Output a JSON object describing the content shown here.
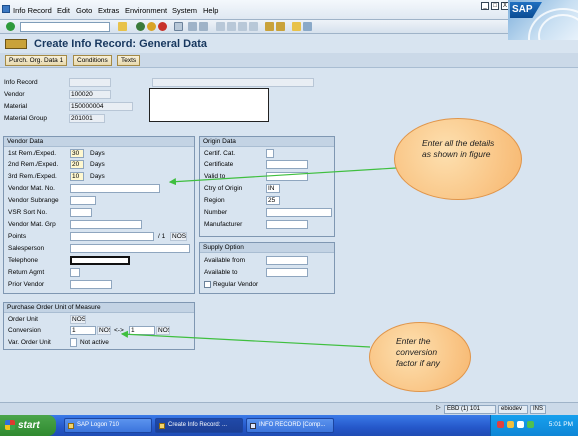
{
  "menu": [
    "Info Record",
    "Edit",
    "Goto",
    "Extras",
    "Environment",
    "System",
    "Help"
  ],
  "window_controls": [
    "_",
    "□",
    "X"
  ],
  "logo_text": "SAP",
  "title": "Create Info Record: General Data",
  "app_buttons": [
    "Purch. Org. Data 1",
    "Conditions",
    "Texts"
  ],
  "header": {
    "info_record_label": "Info Record",
    "info_record_value": "",
    "vendor_label": "Vendor",
    "vendor_value": "100020",
    "material_label": "Material",
    "material_value": "150000004",
    "material_group_label": "Material Group",
    "material_group_value": "201001"
  },
  "vendor_data": {
    "title": "Vendor Data",
    "rem1_label": "1st Rem./Exped.",
    "rem1_value": "30",
    "rem1_unit": "Days",
    "rem2_label": "2nd Rem./Exped.",
    "rem2_value": "20",
    "rem2_unit": "Days",
    "rem3_label": "3rd Rem./Exped.",
    "rem3_value": "10",
    "rem3_unit": "Days",
    "vendor_mat_no_label": "Vendor Mat. No.",
    "vendor_subrange_label": "Vendor Subrange",
    "vsr_sort_no_label": "VSR Sort No.",
    "vendor_mat_grp_label": "Vendor Mat. Grp",
    "points_label": "Points",
    "points_per": "/ 1",
    "points_unit": "NOS",
    "salesperson_label": "Salesperson",
    "telephone_label": "Telephone",
    "return_agmt_label": "Return Agmt",
    "prior_vendor_label": "Prior Vendor"
  },
  "origin_data": {
    "title": "Origin Data",
    "certif_cat_label": "Certif. Cat.",
    "certificate_label": "Certificate",
    "valid_to_label": "Valid to",
    "ctry_label": "Ctry of Origin",
    "ctry_value": "IN",
    "region_label": "Region",
    "region_value": "25",
    "number_label": "Number",
    "manufacturer_label": "Manufacturer"
  },
  "supply_option": {
    "title": "Supply Option",
    "available_from_label": "Available from",
    "available_to_label": "Available to",
    "regular_vendor_label": "Regular Vendor"
  },
  "po_unit": {
    "title": "Purchase Order Unit of Measure",
    "order_unit_label": "Order Unit",
    "order_unit_value": "NOS",
    "conversion_label": "Conversion",
    "conv_left_value": "1",
    "conv_left_unit": "NOS",
    "conv_arrow": "<->",
    "conv_right_value": "1",
    "conv_right_unit": "NOS",
    "var_order_unit_label": "Var. Order Unit",
    "not_active_label": "Not active"
  },
  "callouts": {
    "details": "Enter all the details as shown in figure",
    "conversion": "Enter the conversion factor if any"
  },
  "status": {
    "system": "EBD (1) 101",
    "user": "ebiodev",
    "mode": "INS"
  },
  "taskbar": {
    "start": "start",
    "tasks": [
      "SAP Logon 710",
      "Create Info Record: ...",
      "INFO RECORD [Comp..."
    ],
    "clock": "5:01 PM"
  },
  "colors": {
    "title": "#17375e",
    "callout": "#f7b56c",
    "taskbar": "#2557c9"
  }
}
